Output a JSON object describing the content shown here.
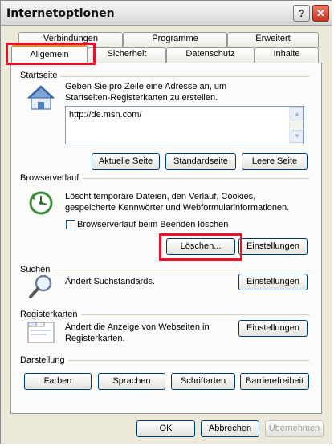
{
  "window": {
    "title": "Internetoptionen"
  },
  "titlebar": {
    "help_glyph": "?",
    "close_glyph": "✕"
  },
  "tabs": {
    "row1": [
      "Verbindungen",
      "Programme",
      "Erweitert"
    ],
    "row2": [
      "Allgemein",
      "Sicherheit",
      "Datenschutz",
      "Inhalte"
    ],
    "active": "Allgemein"
  },
  "startseite": {
    "heading": "Startseite",
    "description_line1": "Geben Sie pro Zeile eine Adresse an, um",
    "description_line2": "Startseiten-Registerkarten zu erstellen.",
    "url_value": "http://de.msn.com/",
    "buttons": {
      "current": "Aktuelle Seite",
      "default": "Standardseite",
      "blank": "Leere Seite"
    },
    "icon": "house-icon"
  },
  "browserverlauf": {
    "heading": "Browserverlauf",
    "description_line1": "Löscht temporäre Dateien, den Verlauf, Cookies,",
    "description_line2": "gespeicherte Kennwörter und Webformularinformationen.",
    "checkbox_label": "Browserverlauf beim Beenden löschen",
    "checkbox_checked": false,
    "buttons": {
      "delete": "Löschen...",
      "settings": "Einstellungen"
    },
    "icon": "history-clock-icon"
  },
  "suchen": {
    "heading": "Suchen",
    "description": "Ändert Suchstandards.",
    "button": "Einstellungen",
    "icon": "magnifier-icon"
  },
  "registerkarten": {
    "heading": "Registerkarten",
    "description_line1": "Ändert die Anzeige von Webseiten in",
    "description_line2": "Registerkarten.",
    "button": "Einstellungen",
    "icon": "tabs-window-icon"
  },
  "darstellung": {
    "heading": "Darstellung",
    "buttons": {
      "colors": "Farben",
      "languages": "Sprachen",
      "fonts": "Schriftarten",
      "accessibility": "Barrierefreiheit"
    }
  },
  "footer": {
    "ok": "OK",
    "cancel": "Abbrechen",
    "apply": "Übernehmen"
  },
  "colors": {
    "highlight_red": "#e8102a",
    "active_tab_accent": "#e68b2c",
    "button_border": "#003c74"
  }
}
